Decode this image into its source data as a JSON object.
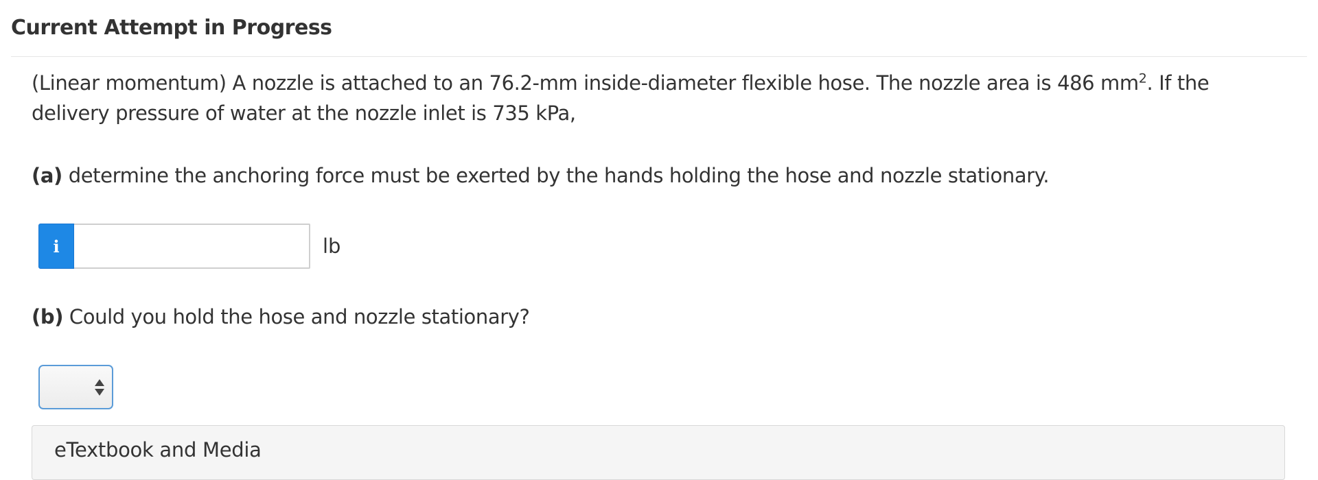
{
  "header": {
    "title": "Current Attempt in Progress"
  },
  "question": {
    "text_before_sup": "(Linear momentum) A nozzle is attached to an 76.2-mm inside-diameter flexible hose. The nozzle area is 486 mm",
    "superscript": "2",
    "text_after_sup": ". If the delivery pressure of water at the nozzle inlet is 735 kPa,"
  },
  "part_a": {
    "label": "(a)",
    "text": " determine the anchoring force must be exerted by the hands holding the hose and nozzle stationary.",
    "info_icon": "info-icon",
    "info_glyph": "i",
    "input_value": "",
    "unit": "lb"
  },
  "part_b": {
    "label": "(b)",
    "text": " Could you hold the hose and nozzle stationary?",
    "select_value": ""
  },
  "etextbook": {
    "title": "eTextbook and Media"
  },
  "colors": {
    "info_button": "#1e88e5",
    "select_border": "#5a9bd8",
    "text": "#333333"
  }
}
